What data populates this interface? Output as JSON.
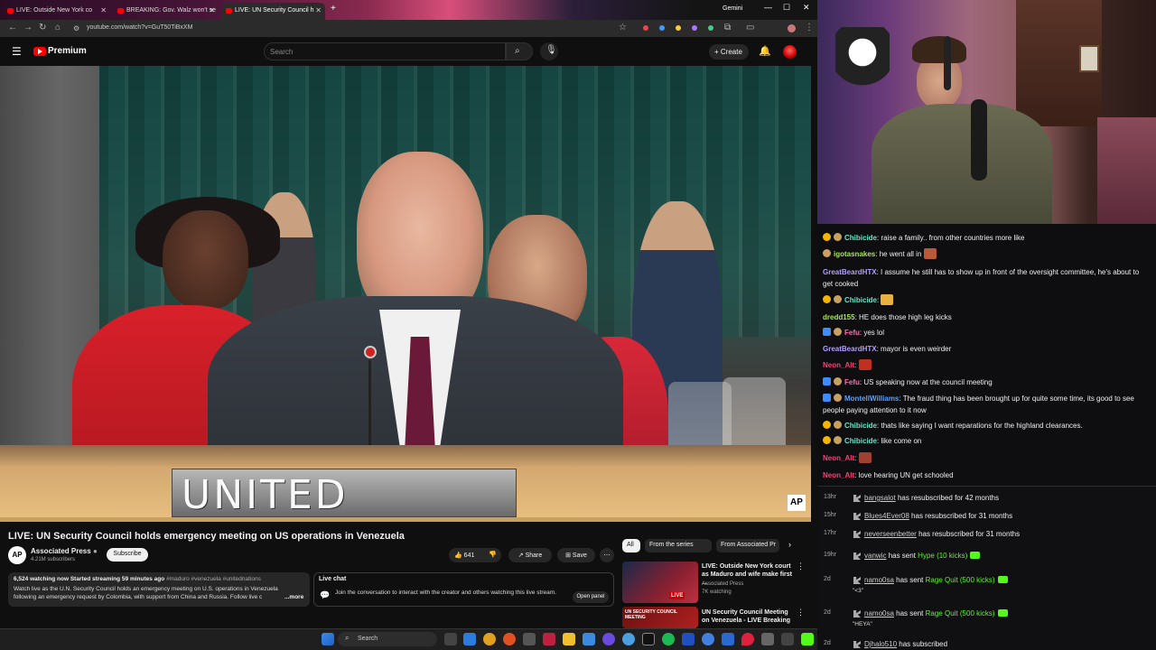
{
  "browser": {
    "tabs": [
      {
        "label": "LIVE: Outside New York co"
      },
      {
        "label": "BREAKING: Gov. Walz won't se"
      },
      {
        "label": "LIVE: UN Security Council h"
      }
    ],
    "profile_label": "Gemini",
    "url": "youtube.com/watch?v=GuT50TiBxXM"
  },
  "youtube": {
    "logo_text": "Premium",
    "search_placeholder": "Search",
    "create_label": "Create",
    "video": {
      "nameplate": "UNITED STATES",
      "watermark": "AP",
      "title": "LIVE: UN Security Council holds emergency meeting on US operations in Venezuela"
    },
    "channel": {
      "avatar": "AP",
      "name": "Associated Press",
      "subs": "4.21M subscribers",
      "subscribe": "Subscribe"
    },
    "actions": {
      "likes": "641",
      "share": "Share",
      "save": "Save"
    },
    "description": {
      "meta": "6,524 watching now  Started streaming 59 minutes ago",
      "tags": "#maduro #venezuela #unitednations",
      "body": "Watch live as the U.N. Security Council holds an emergency meeting on U.S. operations in Venezuela following an emergency request by Colombia, with support from China and Russia. Follow live c",
      "more": "...more"
    },
    "live_chat": {
      "title": "Live chat",
      "body": "Join the conversation to interact with the creator and others watching this live stream.",
      "button": "Open panel"
    },
    "chips": [
      "All",
      "From the series",
      "From Associated Pr"
    ],
    "recommendations": [
      {
        "title": "LIVE: Outside New York court as Maduro and wife make first ...",
        "channel": "Associated Press",
        "meta": "7K watching",
        "thumb_text": "LIVE"
      },
      {
        "title": "UN Security Council Meeting on Venezuela - LIVE Breaking ...",
        "channel": "",
        "meta": "",
        "thumb_text": "UN SECURITY COUNCIL MEETING"
      }
    ]
  },
  "taskbar": {
    "search": "Search"
  },
  "chat": [
    {
      "user": "Chibicide",
      "color": "#5ee8c8",
      "text": "raise a family.. from other countries more like",
      "badge": "#f5b400"
    },
    {
      "user": "igotasnakes",
      "color": "#a8e060",
      "text": "he went all in",
      "badge": "#f5b400"
    },
    {
      "user": "GreatBeardHTX",
      "color": "#b49cff",
      "text": "I assume he still has to show up in front of the oversight committee, he's about to get cooked"
    },
    {
      "user": "Chibicide",
      "color": "#5ee8c8",
      "text": "",
      "badge": "#f5b400"
    },
    {
      "user": "dredd155",
      "color": "#a8e060",
      "text": "HE does those high leg kicks"
    },
    {
      "user": "Fefu",
      "color": "#ff6ab0",
      "text": "yes lol",
      "badge": "#3d8bff"
    },
    {
      "user": "GreatBeardHTX",
      "color": "#b49cff",
      "text": "mayor is even weirder"
    },
    {
      "user": "Neon_Alt",
      "color": "#ff3c78",
      "text": ""
    },
    {
      "user": "Fefu",
      "color": "#ff6ab0",
      "text": "US speaking now at the council meeting",
      "badge": "#3d8bff"
    },
    {
      "user": "MontellWilliams",
      "color": "#5aa0ff",
      "text": "The fraud thing has been brought up for quite some time, its good to see people paying attention to it now",
      "badge": "#3d8bff"
    },
    {
      "user": "Chibicide",
      "color": "#5ee8c8",
      "text": "thats like saying I want reparations for the highland clearances.",
      "badge": "#f5b400"
    },
    {
      "user": "Chibicide",
      "color": "#5ee8c8",
      "text": "like come on",
      "badge": "#f5b400"
    },
    {
      "user": "Neon_Alt",
      "color": "#ff3c78",
      "text": ""
    },
    {
      "user": "Neon_Alt",
      "color": "#ff3c78",
      "text": "love hearing UN get schooled"
    }
  ],
  "events": [
    {
      "time": "13hr",
      "user": "bangsalot",
      "action": "has resubscribed for 42 months"
    },
    {
      "time": "15hr",
      "user": "Blues4Ever08",
      "action": "has resubscribed for 31 months"
    },
    {
      "time": "17hr",
      "user": "neverseenbetter",
      "action": "has resubscribed for 31 months"
    },
    {
      "time": "19hr",
      "user": "vanwic",
      "action": "has sent",
      "gift": "Hype (10 kicks)"
    },
    {
      "time": "2d",
      "user": "namo0sa",
      "action": "has sent",
      "gift": "Rage Quit (500 kicks)",
      "sub": "\"<3\""
    },
    {
      "time": "2d",
      "user": "namo0sa",
      "action": "has sent",
      "gift": "Rage Quit (500 kicks)",
      "sub": "\"HEYA\""
    },
    {
      "time": "2d",
      "user": "Djhalo510",
      "action": "has subscribed"
    }
  ]
}
